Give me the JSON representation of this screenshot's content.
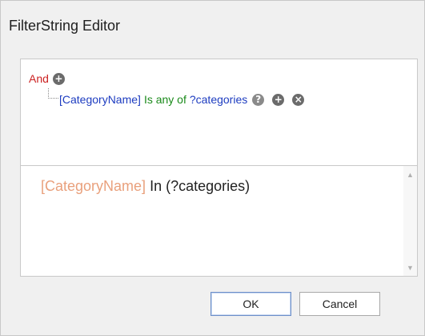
{
  "dialog": {
    "title": "FilterString Editor"
  },
  "tree": {
    "group_operator": "And",
    "add_group_icon": "plus-circle-icon",
    "condition": {
      "field": "[CategoryName]",
      "operator": "Is any of",
      "value": "?categories",
      "help_icon": "question-circle-icon",
      "add_icon": "plus-circle-icon",
      "remove_icon": "close-circle-icon"
    }
  },
  "text_editor": {
    "field": "[CategoryName]",
    "rest": "In (?categories)"
  },
  "buttons": {
    "ok_label": "OK",
    "cancel_label": "Cancel"
  },
  "colors": {
    "group_operator": "#cc2222",
    "field": "#1d3cc0",
    "operator": "#1a8a1a",
    "text_field": "#e9a07c",
    "default_button_border": "#6d8fc9"
  }
}
